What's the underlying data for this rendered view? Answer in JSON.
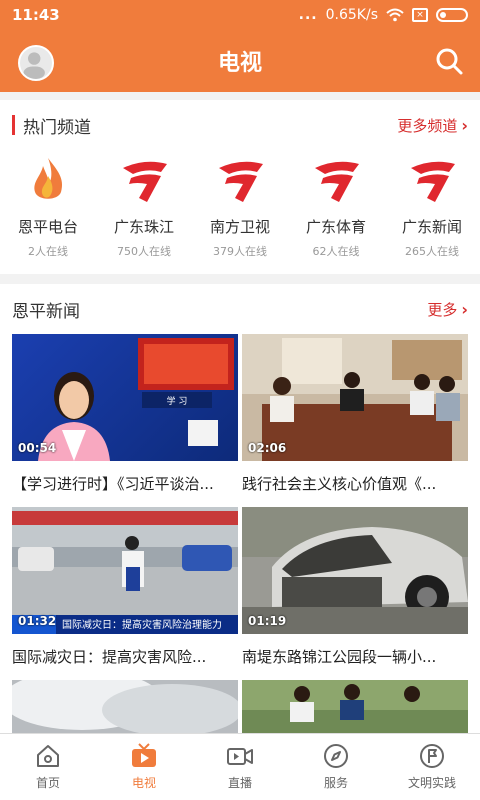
{
  "status_bar": {
    "time": "11:43",
    "dots": "...",
    "net_speed": "0.65K/s"
  },
  "app_bar": {
    "title": "电视"
  },
  "hot_channels": {
    "title": "热门频道",
    "more": "更多频道",
    "items": [
      {
        "name": "恩平电台",
        "online": "2人在线"
      },
      {
        "name": "广东珠江",
        "online": "750人在线"
      },
      {
        "name": "南方卫视",
        "online": "379人在线"
      },
      {
        "name": "广东体育",
        "online": "62人在线"
      },
      {
        "name": "广东新闻",
        "online": "265人在线"
      }
    ]
  },
  "news": {
    "title": "恩平新闻",
    "more": "更多",
    "items": [
      {
        "duration": "00:54",
        "caption": "【学习进行时】《习近平谈治..."
      },
      {
        "duration": "02:06",
        "caption": "践行社会主义核心价值观《..."
      },
      {
        "duration": "01:32",
        "caption": "国际减灾日：提高灾害风险...",
        "banner": "国际减灾日：提高灾害风险治理能力"
      },
      {
        "duration": "01:19",
        "caption": "南堤东路锦江公园段一辆小..."
      }
    ]
  },
  "tabs": [
    {
      "label": "首页",
      "icon": "home-icon"
    },
    {
      "label": "电视",
      "icon": "tv-icon",
      "active": true
    },
    {
      "label": "直播",
      "icon": "live-camera-icon"
    },
    {
      "label": "服务",
      "icon": "compass-icon"
    },
    {
      "label": "文明实践",
      "icon": "flag-badge-icon"
    }
  ],
  "colors": {
    "brand": "#f07c3c",
    "accent_red": "#e53333"
  }
}
